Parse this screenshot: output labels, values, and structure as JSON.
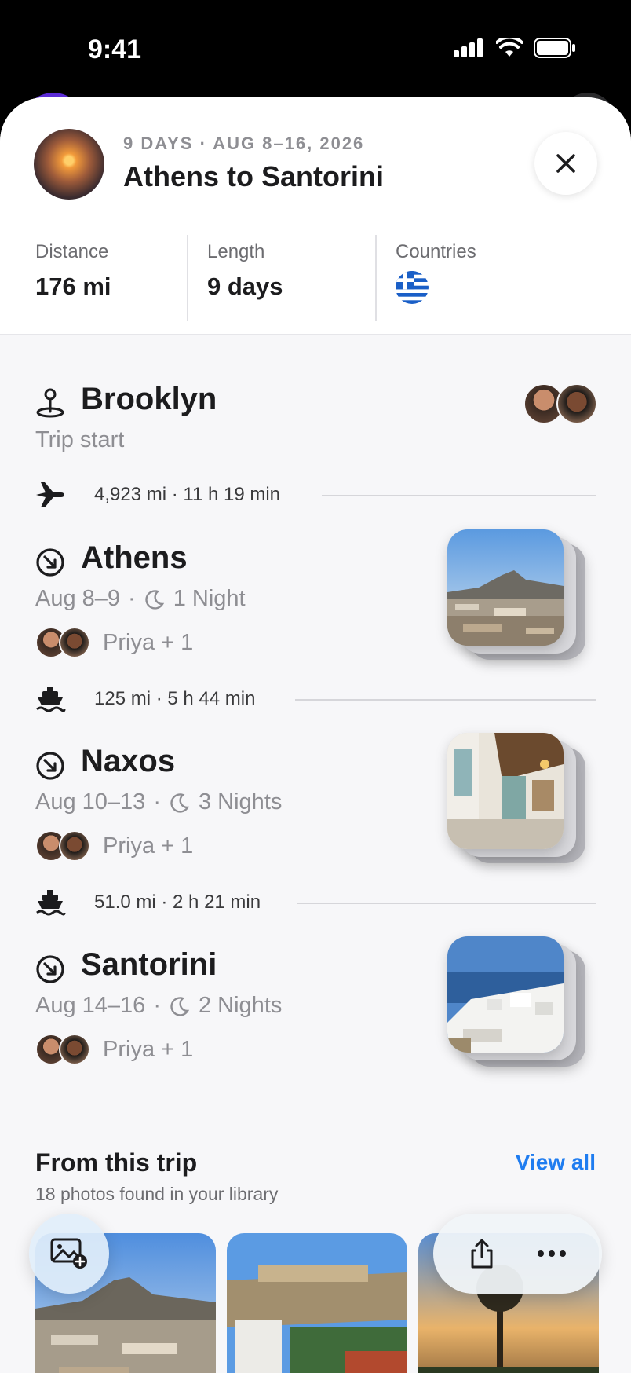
{
  "status_bar": {
    "time": "9:41"
  },
  "header": {
    "meta": "9 DAYS · AUG 8–16, 2026",
    "title": "Athens to Santorini",
    "close_icon": "close-icon"
  },
  "stats": [
    {
      "label": "Distance",
      "value": "176 mi"
    },
    {
      "label": "Length",
      "value": "9 days"
    },
    {
      "label": "Countries",
      "flag": "greece-flag"
    }
  ],
  "itinerary": {
    "start": {
      "name": "Brooklyn",
      "subtitle": "Trip start",
      "icon": "pin-icon"
    },
    "legs": [
      {
        "icon": "airplane-icon",
        "text": "4,923 mi · 11 h 19 min"
      },
      {
        "icon": "ferry-icon",
        "text": "125 mi · 5 h 44 min"
      },
      {
        "icon": "ferry-icon",
        "text": "51.0 mi · 2 h 21 min"
      }
    ],
    "stops": [
      {
        "name": "Athens",
        "dates": "Aug 8–9",
        "nights": "1 Night",
        "people": "Priya + 1"
      },
      {
        "name": "Naxos",
        "dates": "Aug 10–13",
        "nights": "3 Nights",
        "people": "Priya + 1"
      },
      {
        "name": "Santorini",
        "dates": "Aug 14–16",
        "nights": "2 Nights",
        "people": "Priya + 1"
      }
    ]
  },
  "from_trip": {
    "title": "From this trip",
    "subtitle": "18 photos found in your library",
    "view_all": "View all"
  },
  "colors": {
    "accent": "#1e7cf0",
    "sheet_bg": "#f7f7f9",
    "secondary_text": "#8e8e93"
  }
}
